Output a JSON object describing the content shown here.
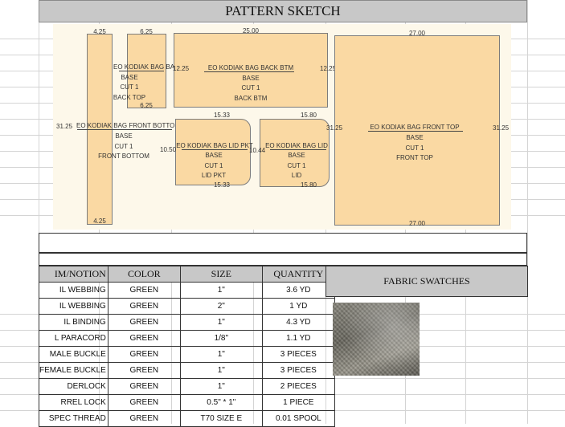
{
  "title": "PATTERN SKETCH",
  "pieces": {
    "back_top": {
      "name": "EO KODIAK BAG BACK TOP",
      "material": "BASE",
      "cut": "CUT 1",
      "part": "BACK TOP",
      "dim_top": "6.25",
      "dim_bottom": "6.25"
    },
    "back_btm": {
      "name": "EO KODIAK BAG BACK BTM",
      "material": "BASE",
      "cut": "CUT 1",
      "part": "BACK BTM",
      "dim_top": "25.00",
      "dim_left": "12.25",
      "dim_right": "12.25"
    },
    "front_bottom": {
      "name": "EO KODIAK BAG FRONT BOTTOM",
      "material": "BASE",
      "cut": "CUT 1",
      "part": "FRONT BOTTOM",
      "dim_top": "4.25",
      "dim_bottom": "4.25",
      "dim_left": "31.25"
    },
    "lid_pkt": {
      "name": "EO KODIAK BAG LID PKT",
      "material": "BASE",
      "cut": "CUT 1",
      "part": "LID PKT",
      "dim_top": "15.33",
      "dim_bottom": "15.33",
      "dim_left": "10.50"
    },
    "lid": {
      "name": "EO KODIAK BAG LID",
      "material": "BASE",
      "cut": "CUT 1",
      "part": "LID",
      "dim_top": "15.80",
      "dim_bottom": "15.80",
      "dim_left": "10.44"
    },
    "front_top": {
      "name": "EO KODIAK BAG FRONT TOP",
      "material": "BASE",
      "cut": "CUT 1",
      "part": "FRONT TOP",
      "dim_top": "27.00",
      "dim_bottom": "27.00",
      "dim_left": "31.25",
      "dim_right": "31.25"
    }
  },
  "table": {
    "headers": [
      "IM/NOTION",
      "COLOR",
      "SIZE",
      "QUANTITY"
    ],
    "rows": [
      [
        "IL WEBBING",
        "GREEN",
        "1\"",
        "3.6 YD"
      ],
      [
        "IL WEBBING",
        "GREEN",
        "2\"",
        "1 YD"
      ],
      [
        "IL BINDING",
        "GREEN",
        "1\"",
        "4.3 YD"
      ],
      [
        "L PARACORD",
        "GREEN",
        "1/8\"",
        "1.1 YD"
      ],
      [
        "MALE BUCKLE",
        "GREEN",
        "1\"",
        "3 PIECES"
      ],
      [
        "FEMALE BUCKLE",
        "GREEN",
        "1\"",
        "3 PIECES"
      ],
      [
        "DERLOCK",
        "GREEN",
        "1\"",
        "2 PIECES"
      ],
      [
        "RREL LOCK",
        "GREEN",
        "0.5\" * 1\"",
        "1 PIECE"
      ],
      [
        "SPEC THREAD",
        "GREEN",
        "T70 SIZE E",
        "0.01 SPOOL"
      ]
    ]
  },
  "swatches": {
    "heading": "FABRIC SWATCHES"
  }
}
